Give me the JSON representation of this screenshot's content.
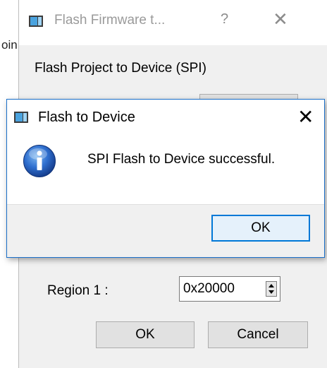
{
  "background_app": {
    "partial_text": "oin"
  },
  "back_dialog": {
    "title": "Flash Firmware t...",
    "help_glyph": "?",
    "close_glyph": "✕",
    "header": "Flash Project to Device (SPI)",
    "region_label": "Region 1 :",
    "region_value": "0x20000",
    "ok_label": "OK",
    "cancel_label": "Cancel"
  },
  "message_box": {
    "title": "Flash to Device",
    "close_glyph": "✕",
    "message": "SPI Flash to Device successful.",
    "ok_label": "OK",
    "icon": "info-icon"
  },
  "colors": {
    "accent": "#0078d7",
    "info_blue": "#1b5fb8",
    "dialog_bg": "#f0f0f0"
  }
}
